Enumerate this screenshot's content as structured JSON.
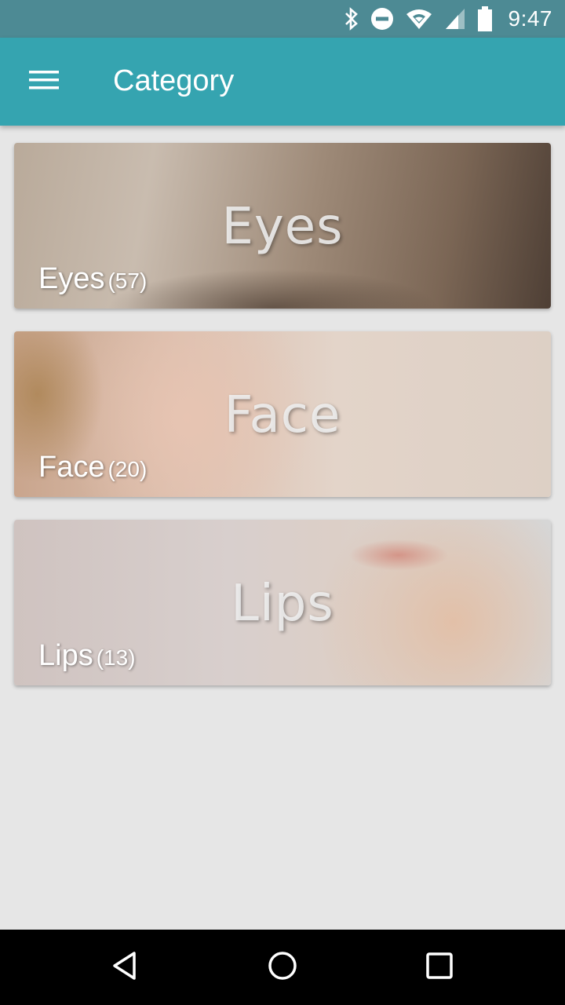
{
  "status_bar": {
    "time": "9:47",
    "icons": [
      "bluetooth-icon",
      "do-not-disturb-icon",
      "wifi-icon",
      "cell-signal-icon",
      "battery-icon"
    ]
  },
  "app_bar": {
    "title": "Category",
    "menu_icon": "hamburger-menu-icon"
  },
  "categories": [
    {
      "name": "Eyes",
      "count": "(57)",
      "overlay_text": "Eyes"
    },
    {
      "name": "Face",
      "count": "(20)",
      "overlay_text": "Face"
    },
    {
      "name": "Lips",
      "count": "(13)",
      "overlay_text": "Lips"
    }
  ],
  "nav_bar": {
    "icons": [
      "back-icon",
      "home-icon",
      "recents-icon"
    ]
  },
  "colors": {
    "app_bar": "#35a4b0",
    "status_bar": "#4d8a94",
    "background": "#e6e6e6",
    "nav_bar": "#000000"
  }
}
